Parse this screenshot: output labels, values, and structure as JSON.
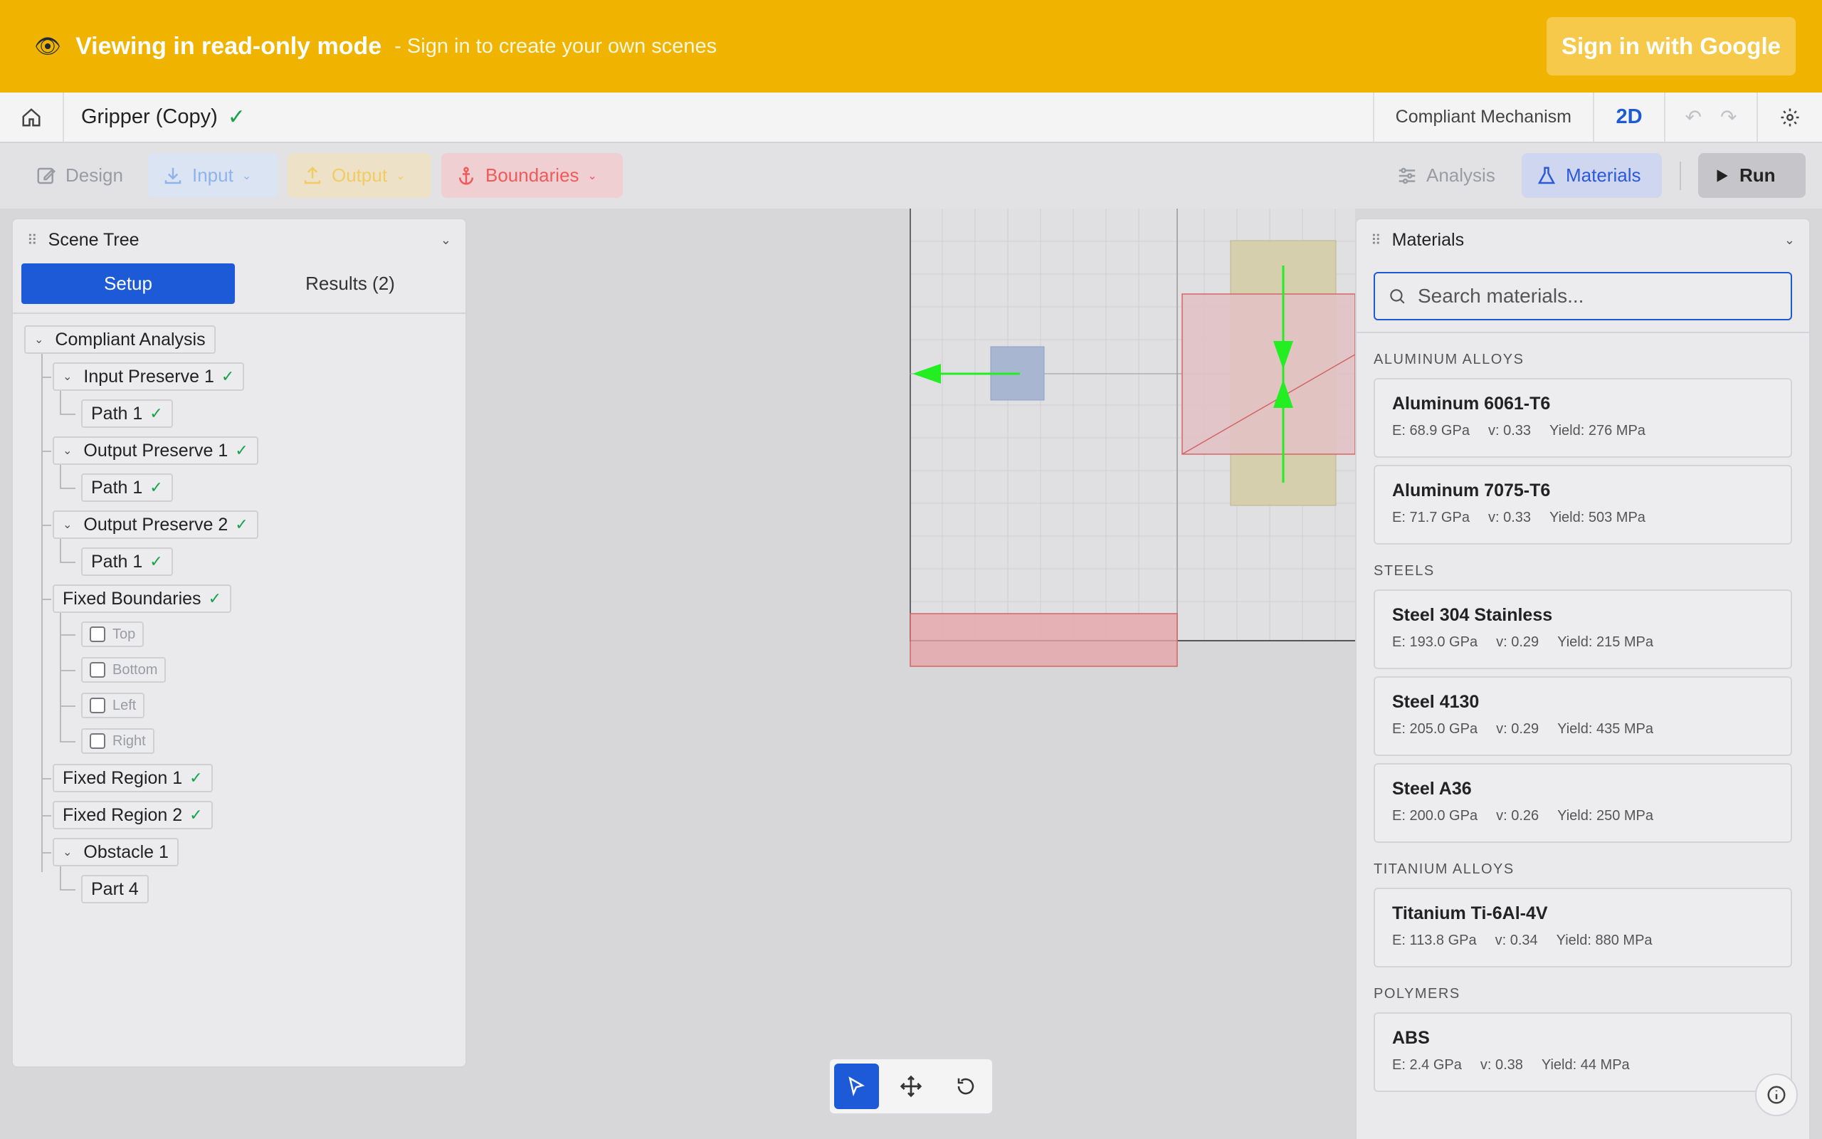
{
  "banner": {
    "eye_icon": "👁",
    "title": "Viewing in read-only mode",
    "subtitle": "- Sign in to create your own scenes",
    "signin_label": "Sign in with Google"
  },
  "header": {
    "scene_title": "Gripper (Copy)",
    "saved_mark": "✓",
    "mode_label": "Compliant Mechanism",
    "view_toggle": "2D"
  },
  "toolbar": {
    "design": "Design",
    "input": "Input",
    "output": "Output",
    "boundaries": "Boundaries",
    "analysis": "Analysis",
    "materials": "Materials",
    "run": "Run"
  },
  "scene_tree": {
    "title": "Scene Tree",
    "tabs": [
      "Setup",
      "Results (2)"
    ],
    "nodes": {
      "root": "Compliant Analysis",
      "input_preserve_1": "Input Preserve 1",
      "path_1a": "Path 1",
      "output_preserve_1": "Output Preserve 1",
      "path_1b": "Path 1",
      "output_preserve_2": "Output Preserve 2",
      "path_1c": "Path 1",
      "fixed_boundaries": "Fixed Boundaries",
      "top": "Top",
      "bottom": "Bottom",
      "left": "Left",
      "right": "Right",
      "fixed_region_1": "Fixed Region 1",
      "fixed_region_2": "Fixed Region 2",
      "obstacle_1": "Obstacle 1",
      "part_4": "Part 4"
    },
    "check_mark": "✓"
  },
  "materials": {
    "title": "Materials",
    "search_placeholder": "Search materials...",
    "categories": [
      {
        "name": "ALUMINUM ALLOYS",
        "items": [
          {
            "name": "Aluminum 6061-T6",
            "e": "E: 68.9 GPa",
            "v": "v: 0.33",
            "y": "Yield: 276 MPa"
          },
          {
            "name": "Aluminum 7075-T6",
            "e": "E: 71.7 GPa",
            "v": "v: 0.33",
            "y": "Yield: 503 MPa"
          }
        ]
      },
      {
        "name": "STEELS",
        "items": [
          {
            "name": "Steel 304 Stainless",
            "e": "E: 193.0 GPa",
            "v": "v: 0.29",
            "y": "Yield: 215 MPa"
          },
          {
            "name": "Steel 4130",
            "e": "E: 205.0 GPa",
            "v": "v: 0.29",
            "y": "Yield: 435 MPa"
          },
          {
            "name": "Steel A36",
            "e": "E: 200.0 GPa",
            "v": "v: 0.26",
            "y": "Yield: 250 MPa"
          }
        ]
      },
      {
        "name": "TITANIUM ALLOYS",
        "items": [
          {
            "name": "Titanium Ti-6Al-4V",
            "e": "E: 113.8 GPa",
            "v": "v: 0.34",
            "y": "Yield: 880 MPa"
          }
        ]
      },
      {
        "name": "POLYMERS",
        "items": [
          {
            "name": "ABS",
            "e": "E: 2.4 GPa",
            "v": "v: 0.38",
            "y": "Yield: 44 MPa"
          }
        ]
      }
    ]
  },
  "colors": {
    "banner": "#f0b400",
    "accent": "#1d5ad8",
    "success": "#16a34a",
    "boundary": "#ef5a5a",
    "arrow": "#22ee22"
  }
}
